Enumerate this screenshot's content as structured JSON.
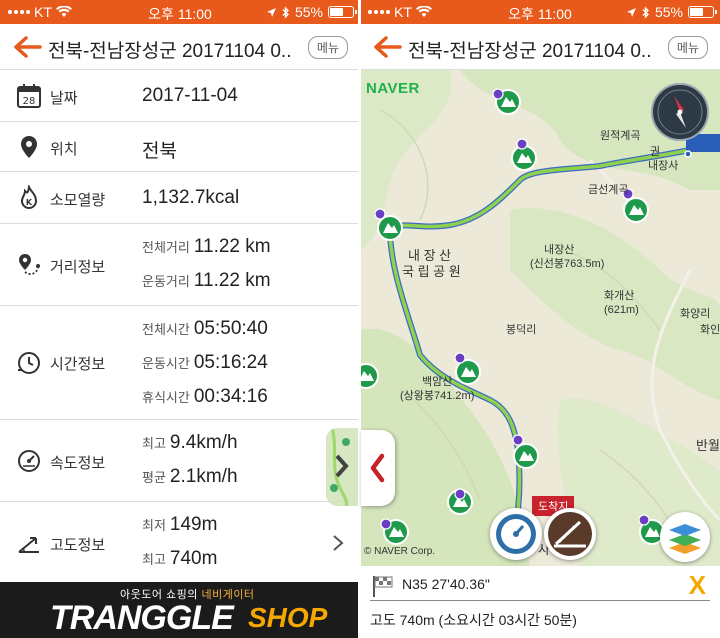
{
  "status_bar": {
    "carrier": "KT",
    "time": "오후 11:00",
    "battery": "55%"
  },
  "header": {
    "title": "전북-전남장성군 20171104 0...",
    "menu_label": "메뉴"
  },
  "info": {
    "date": {
      "label": "날짜",
      "value": "2017-11-04",
      "icon": "calendar-icon"
    },
    "location": {
      "label": "위치",
      "value": "전북",
      "icon": "pin-icon"
    },
    "calories": {
      "label": "소모열량",
      "value": "1,132.7kcal",
      "icon": "fire-icon"
    },
    "distance": {
      "label": "거리정보",
      "icon": "route-pin-icon",
      "total_key": "전체거리",
      "total_value": "11.22 km",
      "moving_key": "운동거리",
      "moving_value": "11.22 km"
    },
    "time": {
      "label": "시간정보",
      "icon": "clock-icon",
      "total_key": "전체시간",
      "total_value": "05:50:40",
      "moving_key": "운동시간",
      "moving_value": "05:16:24",
      "rest_key": "휴식시간",
      "rest_value": "00:34:16"
    },
    "speed": {
      "label": "속도정보",
      "icon": "speedometer-icon",
      "max_key": "최고",
      "max_value": "9.4km/h",
      "avg_key": "평균",
      "avg_value": "2.1km/h"
    },
    "altitude": {
      "label": "고도정보",
      "icon": "altitude-icon",
      "min_key": "최저",
      "min_value": "149m",
      "max_key": "최고",
      "max_value": "740m"
    }
  },
  "banner": {
    "tagline_prefix": "아웃도어 쇼핑의 ",
    "tagline_highlight": "네비게이터",
    "brand": "TRANGGLE",
    "shop": "SHOP"
  },
  "map": {
    "provider": "NAVER",
    "copyright": "© NAVER Corp.",
    "labels": {
      "wonjeok": "원적계곡",
      "naejangsa": "내장사",
      "geumseon": "금선계곡",
      "naejangsan": "내장산",
      "sinseonbong": "(신선봉763.5m)",
      "park_line1": "내 장 산",
      "park_line2": "국 립 공 원",
      "hwagaesan": "화개산",
      "hwagaesan_alt": "(621m)",
      "hwayangri": "화양리",
      "bongdeokri": "봉덕리",
      "baegamsan": "백암산",
      "sangwangbong": "(상왕봉741.2m)",
      "banwol": "반월",
      "finish": "도착지",
      "edge_gwon": "권",
      "edge_hwa": "화인",
      "edge_sa": "사"
    },
    "colors": {
      "route": "#8fd14f",
      "route_outline": "#3a6cc0",
      "marker_green": "#1e9a4a",
      "marker_purple": "#6b3fc4",
      "accent": "#e85a1c"
    }
  },
  "coordinates": {
    "latitude": "N35 27'40.36\"",
    "close_label": "X",
    "altitude_text": "고도 740m (소요시간 03시간 50분)"
  }
}
